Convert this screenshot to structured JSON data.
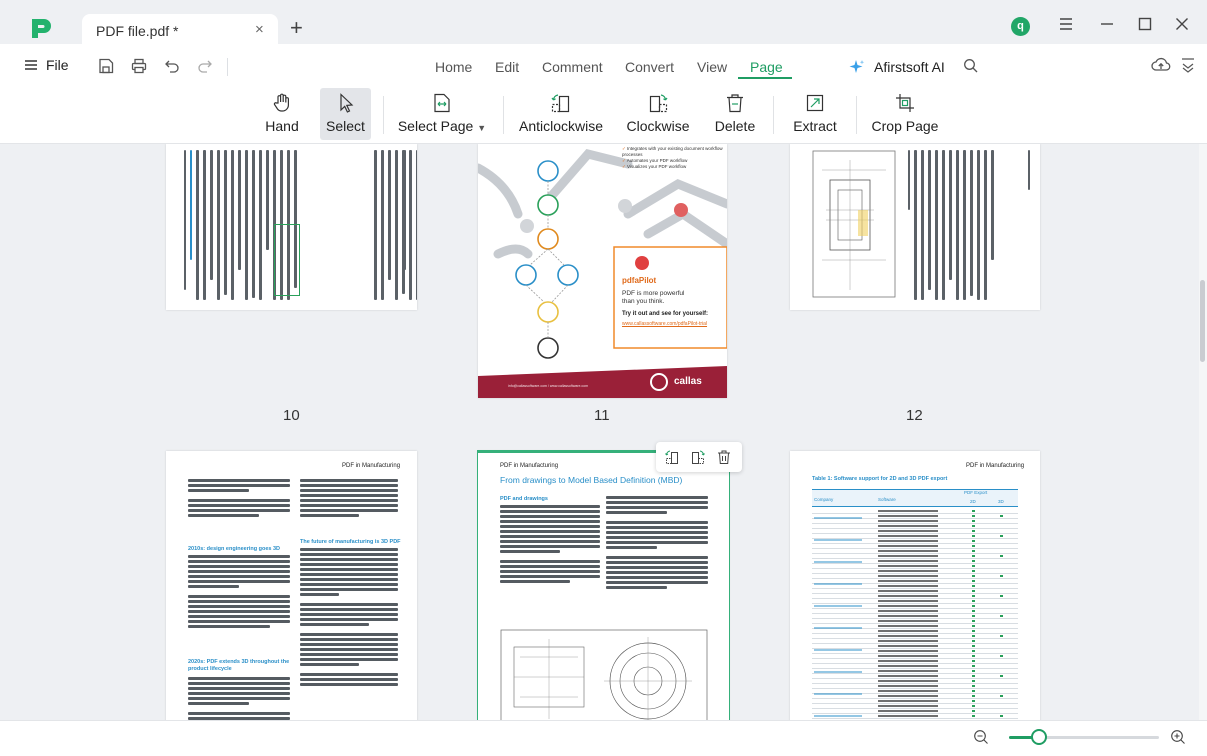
{
  "titlebar": {
    "tab_title": "PDF file.pdf *",
    "tab_close": "×",
    "tab_add": "+",
    "avatar_letter": "q",
    "brand_color": "#1f9d63"
  },
  "menubar": {
    "file_label": "File",
    "tabs": [
      {
        "label": "Home"
      },
      {
        "label": "Edit"
      },
      {
        "label": "Comment"
      },
      {
        "label": "Convert"
      },
      {
        "label": "View"
      },
      {
        "label": "Page"
      }
    ],
    "active_tab": "Page",
    "ai_label": "Afirstsoft AI"
  },
  "ribbon": {
    "tools": [
      {
        "label": "Hand",
        "icon": "hand-icon"
      },
      {
        "label": "Select",
        "icon": "cursor-icon"
      },
      {
        "label": "Select Page",
        "icon": "select-page-icon"
      },
      {
        "label": "Anticlockwise",
        "icon": "rotate-anticlockwise-icon"
      },
      {
        "label": "Clockwise",
        "icon": "rotate-clockwise-icon"
      },
      {
        "label": "Delete",
        "icon": "trash-icon"
      },
      {
        "label": "Extract",
        "icon": "extract-icon"
      },
      {
        "label": "Crop Page",
        "icon": "crop-icon"
      }
    ],
    "active_tool": "Select"
  },
  "pages": {
    "page_numbers": [
      "10",
      "11",
      "12"
    ],
    "page13": {
      "header": "PDF in Manufacturing",
      "heading1": "2010s: design engineering goes 3D",
      "heading2": "2020s: PDF extends 3D throughout the product lifecycle",
      "heading3": "The future of manufacturing is 3D PDF"
    },
    "page14": {
      "header": "PDF in Manufacturing",
      "title": "From drawings to Model Based Definition (MBD)",
      "heading1": "PDF and drawings"
    },
    "page15": {
      "header": "PDF in Manufacturing",
      "table_title": "Table 1: Software support for 2D and 3D PDF export",
      "col_company": "Company",
      "col_software": "Software",
      "col_pdf_export": "PDF Export",
      "col_2d": "2D",
      "col_3d": "3D"
    },
    "page11": {
      "brand": "pdfaPilot",
      "tagline1": "PDF is more powerful",
      "tagline2": "than you think.",
      "cta": "Try it out and see for yourself:",
      "link": "www.callassoftware.com/pdfaPilot-trial",
      "footer_brand": "callas",
      "footer_text": "info@callassoftware.com / www.callassoftware.com",
      "bullet1": "Integrates with your existing document workflow processes",
      "bullet2": "Automates your PDF workflow",
      "bullet3": "Visualizes your PDF workflow"
    }
  },
  "statusbar": {
    "zoom_level": 0.2
  }
}
